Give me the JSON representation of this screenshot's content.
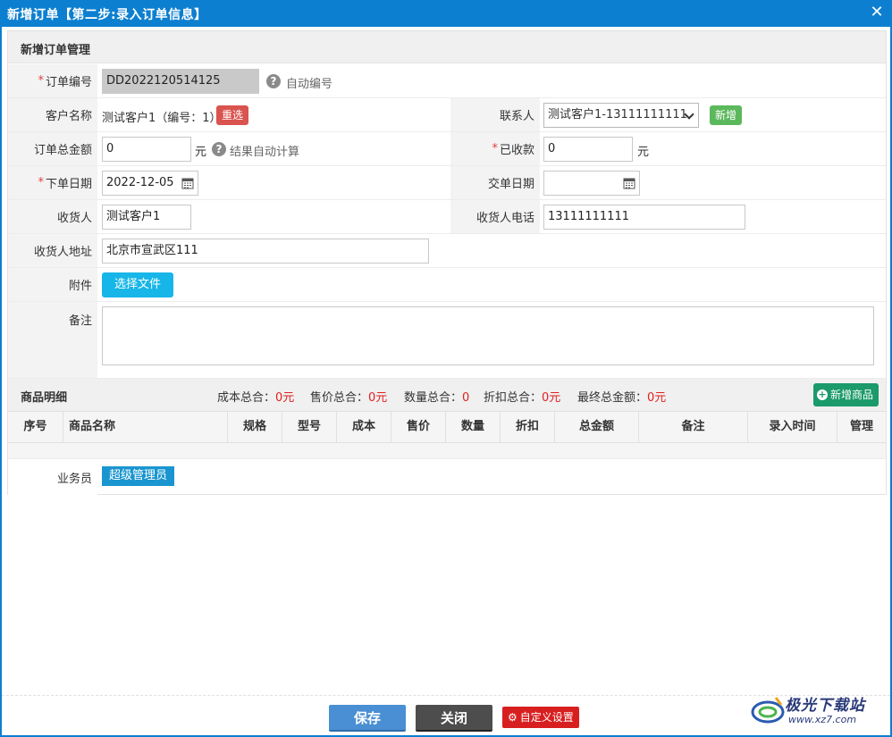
{
  "window": {
    "title": "新增订单【第二步:录入订单信息】",
    "close_glyph": "✕"
  },
  "panel": {
    "title": "新增订单管理"
  },
  "form": {
    "order_no": {
      "label": "订单编号",
      "value": "DD2022120514125",
      "hint": "自动编号"
    },
    "customer": {
      "label": "客户名称",
      "value": "测试客户1（编号：1）",
      "reselect": "重选"
    },
    "contact": {
      "label": "联系人",
      "value": "测试客户1-13111111111",
      "add": "新增"
    },
    "total_amount": {
      "label": "订单总金额",
      "value": "0",
      "unit": "元",
      "hint": "结果自动计算"
    },
    "received": {
      "label": "已收款",
      "value": "0",
      "unit": "元"
    },
    "order_date": {
      "label": "下单日期",
      "value": "2022-12-05"
    },
    "delivery_date": {
      "label": "交单日期",
      "value": ""
    },
    "receiver": {
      "label": "收货人",
      "value": "测试客户1"
    },
    "receiver_phone": {
      "label": "收货人电话",
      "value": "13111111111"
    },
    "receiver_address": {
      "label": "收货人地址",
      "value": "北京市宣武区111"
    },
    "attachment": {
      "label": "附件",
      "button": "选择文件"
    },
    "remark": {
      "label": "备注",
      "value": ""
    },
    "required_mark": "*"
  },
  "goods": {
    "title": "商品明细",
    "totals": [
      {
        "label": "成本总合：",
        "value": "0元"
      },
      {
        "label": "售价总合：",
        "value": "0元"
      },
      {
        "label": "数量总合：",
        "value": "0"
      },
      {
        "label": "折扣总合：",
        "value": "0元"
      },
      {
        "label": "最终总金额：",
        "value": "0元"
      }
    ],
    "add_button": "新增商品",
    "columns": [
      "序号",
      "商品名称",
      "规格",
      "型号",
      "成本",
      "售价",
      "数量",
      "折扣",
      "总金额",
      "备注",
      "录入时间",
      "管理"
    ]
  },
  "salesperson": {
    "label": "业务员",
    "value": "超级管理员"
  },
  "actions": {
    "save": "保存",
    "close": "关闭",
    "custom": "自定义设置"
  },
  "watermark": {
    "text": "极光下载站",
    "url": "www.xz7.com"
  },
  "colors": {
    "titlebar": "#0d7fd0",
    "required": "#e04040",
    "reselect": "#d9534f",
    "add": "#5cb85c",
    "file": "#17b6e8",
    "add_goods": "#1b9a6b",
    "save": "#4a8fd3",
    "close": "#4d4d4d",
    "custom": "#d81f1f"
  }
}
